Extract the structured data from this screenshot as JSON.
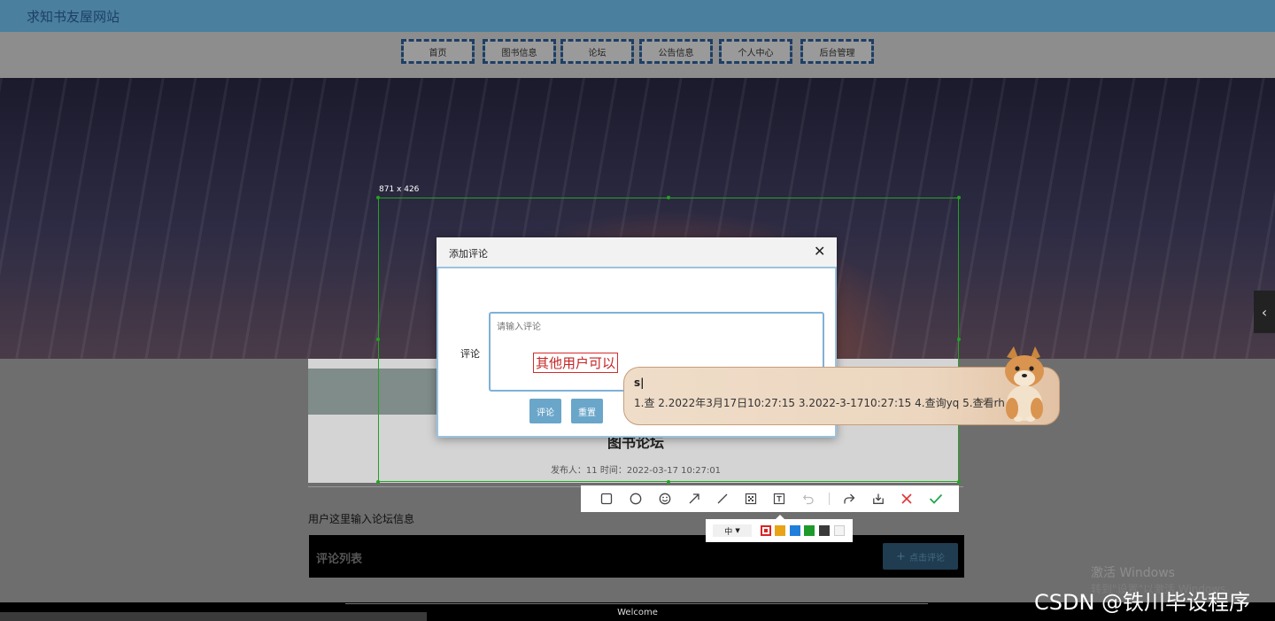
{
  "site": {
    "title": "求知书友屋网站"
  },
  "nav": {
    "items": [
      "首页",
      "图书信息",
      "论坛",
      "公告信息",
      "个人中心",
      "后台管理"
    ]
  },
  "selection": {
    "size_label": "871 x 426"
  },
  "dialog": {
    "title": "添加评论",
    "close_glyph": "✕",
    "field_label": "评论",
    "placeholder": "请输入评论",
    "annotation_text": "其他用户可以",
    "submit_label": "评论",
    "reset_label": "重置"
  },
  "forum": {
    "title": "图书论坛",
    "meta": "发布人：11 时间：2022-03-17 10:27:01",
    "note": "用户这里输入论坛信息",
    "comments_title": "评论列表",
    "add_comment_label": "点击评论",
    "add_comment_icon": "plus-icon"
  },
  "ime": {
    "input": "s|",
    "candidates": "1.查  2.2022年3月17日10:27:15  3.2022-3-1710:27:15  4.查询yq  5.查看rh",
    "next_glyph": "‹›"
  },
  "toolbar": {
    "tools": [
      "rectangle-icon",
      "circle-icon",
      "emoji-icon",
      "arrow-icon",
      "line-icon",
      "mosaic-icon",
      "text-icon",
      "undo-icon",
      "share-icon",
      "download-icon",
      "cancel-icon",
      "confirm-icon"
    ],
    "size_label": "中",
    "colors": [
      "#d92525",
      "#e8a317",
      "#1f7fd9",
      "#1e9a2a",
      "#3a3a3a",
      "#f4f4f4"
    ]
  },
  "footer": {
    "text": "Welcome"
  },
  "watermark": {
    "windows_line1": "激活 Windows",
    "windows_line2": "转到\"设置\"以激活 Windows。",
    "csdn": "CSDN @铁川毕设程序"
  },
  "side": {
    "collapse_glyph": "‹"
  }
}
